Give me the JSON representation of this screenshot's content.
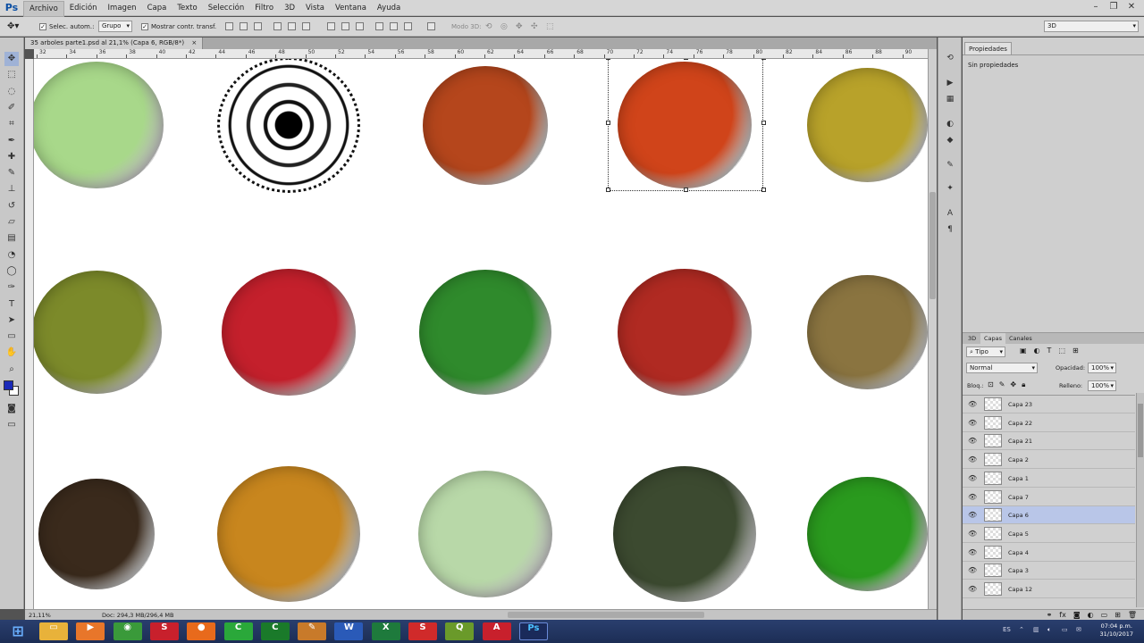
{
  "app": {
    "logo": "Ps"
  },
  "menu": [
    "Archivo",
    "Edición",
    "Imagen",
    "Capa",
    "Texto",
    "Selección",
    "Filtro",
    "3D",
    "Vista",
    "Ventana",
    "Ayuda"
  ],
  "window_controls": [
    "–",
    "❐",
    "✕"
  ],
  "options": {
    "auto_select_label": "Selec. autom.:",
    "auto_select_value": "Grupo",
    "show_transform_label": "Mostrar contr. transf.",
    "mode3d_label": "Modo 3D:",
    "workspace": "3D"
  },
  "document": {
    "tab_title": "35 arboles parte1.psd al 21,1% (Capa 6, RGB/8*)",
    "tab_close": "×",
    "ruler_numbers": [
      "32",
      "34",
      "36",
      "38",
      "40",
      "42",
      "44",
      "46",
      "48",
      "50",
      "52",
      "54",
      "56",
      "58",
      "60",
      "62",
      "64",
      "66",
      "68",
      "70",
      "72",
      "74",
      "76",
      "78",
      "80",
      "82",
      "84",
      "86",
      "88",
      "90"
    ],
    "zoom": "21,11%",
    "doc_info": "Doc: 294,3 MB/296,4 MB"
  },
  "tree_colors": {
    "row1": [
      "#a8d88a",
      "#111111",
      "#b5461c",
      "#d0441a",
      "#b8a22a"
    ],
    "row2": [
      "#7c8a2a",
      "#c4202c",
      "#2f8a2c",
      "#b02a22",
      "#8a7440"
    ],
    "row3": [
      "#3a2a1c",
      "#c8861e",
      "#b8d8a8",
      "#3c4a30",
      "#2a9a1e"
    ]
  },
  "properties": {
    "tab": "Propiedades",
    "empty": "Sin propiedades"
  },
  "layers_panel": {
    "tabs": [
      "3D",
      "Capas",
      "Canales"
    ],
    "filter": "Tipo",
    "blend_mode": "Normal",
    "opacity_label": "Opacidad:",
    "opacity_value": "100%",
    "lock_label": "Bloq.:",
    "fill_label": "Relleno:",
    "fill_value": "100%",
    "layers": [
      {
        "name": "Capa 23",
        "selected": false
      },
      {
        "name": "Capa 22",
        "selected": false
      },
      {
        "name": "Capa 21",
        "selected": false
      },
      {
        "name": "Capa 2",
        "selected": false
      },
      {
        "name": "Capa 1",
        "selected": false
      },
      {
        "name": "Capa 7",
        "selected": false
      },
      {
        "name": "Capa 6",
        "selected": true
      },
      {
        "name": "Capa 5",
        "selected": false
      },
      {
        "name": "Capa 4",
        "selected": false
      },
      {
        "name": "Capa 3",
        "selected": false
      },
      {
        "name": "Capa 12",
        "selected": false
      }
    ]
  },
  "taskbar": {
    "apps": [
      {
        "name": "windows-start-icon",
        "glyph": "⊞",
        "color": "#2b7de0"
      },
      {
        "name": "file-explorer-icon",
        "glyph": "▭",
        "color": "#e8b23a"
      },
      {
        "name": "media-player-icon",
        "glyph": "▶",
        "color": "#e8762a"
      },
      {
        "name": "chrome-icon",
        "glyph": "◉",
        "color": "#3a9a3a"
      },
      {
        "name": "sketchup-icon",
        "glyph": "S",
        "color": "#c8202c"
      },
      {
        "name": "firefox-icon",
        "glyph": "●",
        "color": "#e86a1c"
      },
      {
        "name": "camtasia-icon",
        "glyph": "C",
        "color": "#2aa83a"
      },
      {
        "name": "camtasia-recorder-icon",
        "glyph": "C",
        "color": "#1a7a2a"
      },
      {
        "name": "tool-icon",
        "glyph": "✎",
        "color": "#c87a2a"
      },
      {
        "name": "word-icon",
        "glyph": "W",
        "color": "#2a5ab8"
      },
      {
        "name": "excel-icon",
        "glyph": "X",
        "color": "#1e7a3c"
      },
      {
        "name": "sketchup-layout-icon",
        "glyph": "S",
        "color": "#d02a2a"
      },
      {
        "name": "qgis-icon",
        "glyph": "Q",
        "color": "#6a9a2a"
      },
      {
        "name": "autocad-icon",
        "glyph": "A",
        "color": "#c8202c"
      },
      {
        "name": "photoshop-icon",
        "glyph": "Ps",
        "color": "#1a2a5a"
      }
    ],
    "lang": "ES",
    "time": "07:04 p.m.",
    "date": "31/10/2017"
  }
}
